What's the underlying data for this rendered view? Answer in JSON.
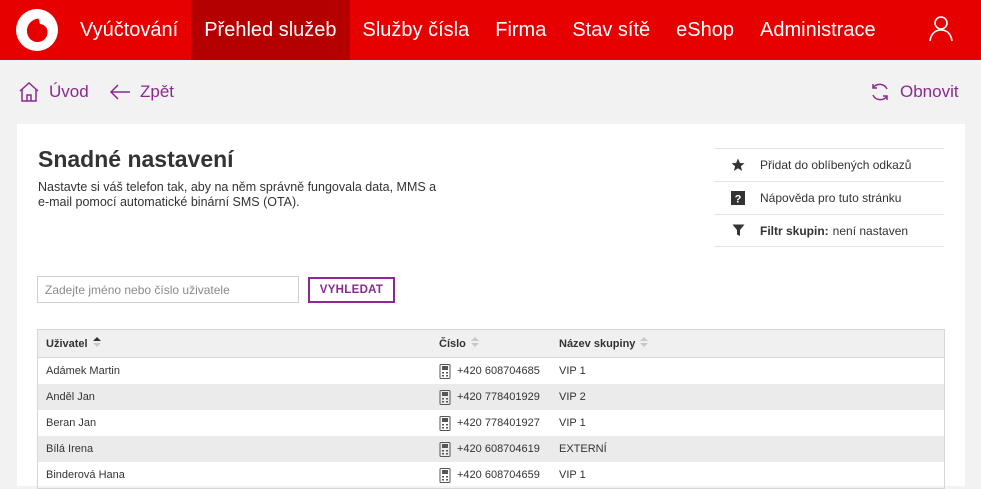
{
  "nav": {
    "items": [
      {
        "label": "Vyúčtování",
        "active": false
      },
      {
        "label": "Přehled služeb",
        "active": true
      },
      {
        "label": "Služby čísla",
        "active": false
      },
      {
        "label": "Firma",
        "active": false
      },
      {
        "label": "Stav sítě",
        "active": false
      },
      {
        "label": "eShop",
        "active": false
      },
      {
        "label": "Administrace",
        "active": false
      }
    ]
  },
  "subbar": {
    "home_label": "Úvod",
    "back_label": "Zpět",
    "refresh_label": "Obnovit"
  },
  "page": {
    "title": "Snadné nastavení",
    "description": "Nastavte si váš telefon tak, aby na něm správně fungovala data, MMS a e-mail pomocí automatické binární SMS (OTA)."
  },
  "side_links": {
    "favorite": "Přidat do oblíbených odkazů",
    "help": "Nápověda pro tuto stránku",
    "filter_label": "Filtr skupin:",
    "filter_value": "není nastaven"
  },
  "search": {
    "placeholder": "Zadejte jméno nebo číslo uživatele",
    "button_label": "VYHLEDAT"
  },
  "table": {
    "headers": {
      "user": "Uživatel",
      "number": "Číslo",
      "group": "Název skupiny"
    },
    "rows": [
      {
        "user": "Adámek Martin",
        "number": "+420 608704685",
        "group": "VIP 1"
      },
      {
        "user": "Anděl Jan",
        "number": "+420 778401929",
        "group": "VIP 2"
      },
      {
        "user": "Beran Jan",
        "number": "+420 778401927",
        "group": "VIP 1"
      },
      {
        "user": "Bílá Irena",
        "number": "+420 608704619",
        "group": "EXTERNÍ"
      },
      {
        "user": "Binderová Hana",
        "number": "+420 608704659",
        "group": "VIP 1"
      }
    ]
  },
  "colors": {
    "brand": "#e60000",
    "brand_dark": "#b40000",
    "accent": "#8a2a8f"
  }
}
